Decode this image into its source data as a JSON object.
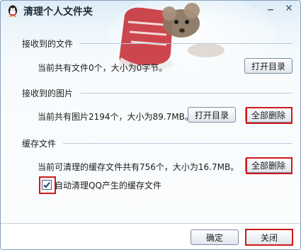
{
  "window": {
    "title": "清理个人文件夹",
    "app_icon": "qq-penguin-icon",
    "minimize_icon": "minimize-icon",
    "close_icon": "close-icon"
  },
  "received_files": {
    "heading": "接收到的文件",
    "info": "当前共有文件0个，大小为0字节。",
    "open_button": "打开目录"
  },
  "received_images": {
    "heading": "接收到的图片",
    "info": "当前共有图片2194个，大小为89.7MB。",
    "open_button": "打开目录",
    "delete_button": "全部删除"
  },
  "cache_files": {
    "heading": "缓存文件",
    "info": "当前可清理的缓存文件共有756个，大小为16.7MB。",
    "delete_button": "全部删除",
    "auto_clean_label": "自动清理QQ产生的缓存文件",
    "auto_clean_checked": true
  },
  "footer": {
    "ok_button": "确定",
    "close_button": "关闭"
  },
  "colors": {
    "highlight": "#d11a1a",
    "accent": "#2f6fb3"
  }
}
